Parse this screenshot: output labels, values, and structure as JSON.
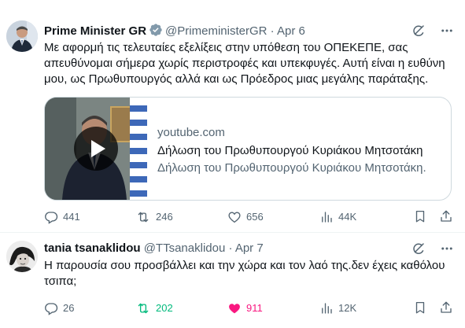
{
  "tweets": [
    {
      "name": "Prime Minister GR",
      "handle": "@PrimeministerGR",
      "sep": "·",
      "date": "Apr 6",
      "text": "Με αφορμή τις τελευταίες εξελίξεις στην υπόθεση του ΟΠΕΚΕΠΕ, σας απευθύνομαι σήμερα χωρίς περιστροφές και υπεκφυγές. Αυτή είναι η ευθύνη μου, ως Πρωθυπουργός αλλά και ως Πρόεδρος μιας μεγάλης παράταξης.",
      "card": {
        "domain": "youtube.com",
        "title": "Δήλωση του Πρωθυπουργού Κυριάκου Μητσοτάκη",
        "description": "Δήλωση του Πρωθυπουργού Κυριάκου Μητσοτάκη."
      },
      "stats": {
        "replies": "441",
        "reposts": "246",
        "likes": "656",
        "views": "44K"
      }
    },
    {
      "name": "tania tsanaklidou",
      "handle": "@TTsanaklidou",
      "sep": "·",
      "date": "Apr 7",
      "text": "Η παρουσία σου προσβάλλει και την χώρα και τον λαό της.δεν έχεις καθόλου τσιπα;",
      "stats": {
        "replies": "26",
        "reposts": "202",
        "likes": "911",
        "views": "12K"
      }
    }
  ],
  "icons": {
    "verified": "verified-badge-icon",
    "grok": "grok-icon",
    "more": "more-icon",
    "reply": "reply-icon",
    "repost": "repost-icon",
    "like": "like-icon",
    "views": "views-icon",
    "bookmark": "bookmark-icon",
    "share": "share-icon",
    "play": "play-icon"
  },
  "colors": {
    "verified": "#829aab",
    "text": "#0f1419",
    "muted": "#536471",
    "repost_active": "#00ba7c",
    "like_active": "#f91880",
    "border": "#cfd9de"
  }
}
